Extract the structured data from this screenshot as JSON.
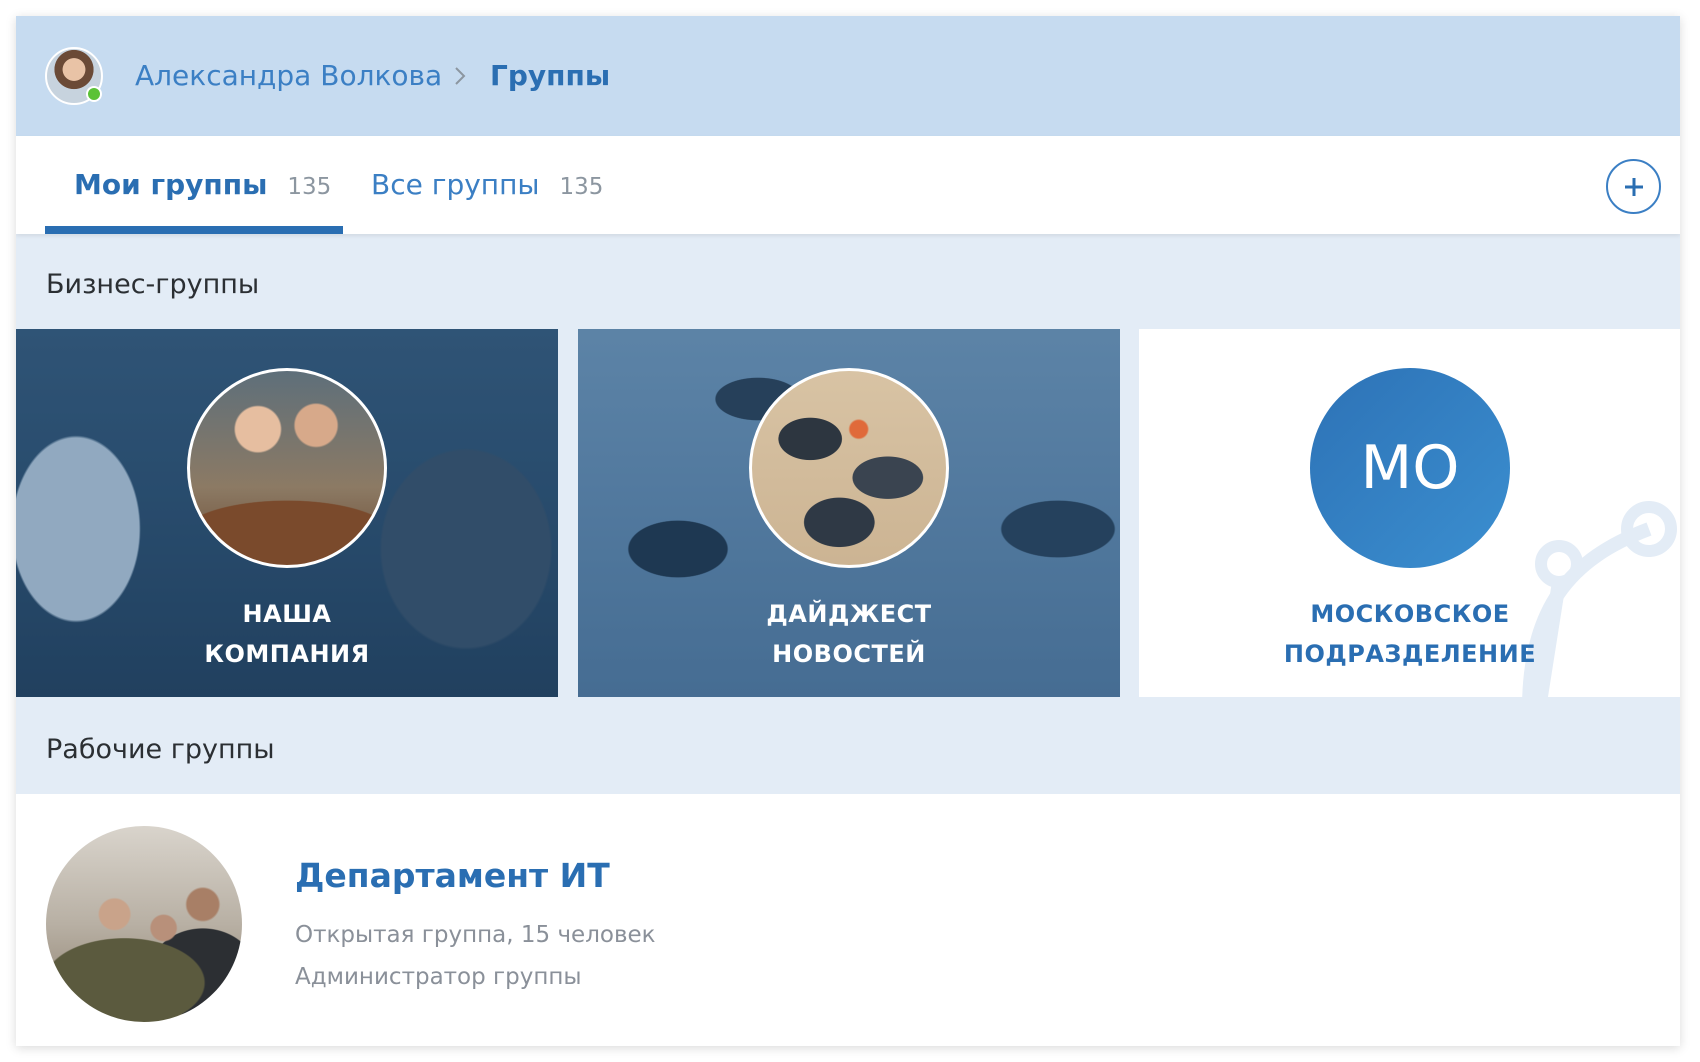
{
  "header": {
    "user_name": "Александра Волкова",
    "current_page": "Группы"
  },
  "tabs": [
    {
      "label": "Мои группы",
      "count": "135",
      "active": true
    },
    {
      "label": "Все группы",
      "count": "135",
      "active": false
    }
  ],
  "sections": {
    "business": "Бизнес-группы",
    "work": "Рабочие группы"
  },
  "business_groups": [
    {
      "title_line1": "НАША",
      "title_line2": "КОМПАНИЯ"
    },
    {
      "title_line1": "ДАЙДЖЕСТ",
      "title_line2": "НОВОСТЕЙ"
    },
    {
      "initials": "МО",
      "title_line1": "МОСКОВСКОЕ",
      "title_line2": "ПОДРАЗДЕЛЕНИЕ"
    }
  ],
  "work_groups": [
    {
      "title": "Департамент ИТ",
      "meta": "Открытая группа, 15 человек",
      "role": "Администратор группы"
    }
  ],
  "colors": {
    "accent": "#2a6eb2",
    "header_bg": "#c6dbf0",
    "page_bg": "#e3ecf6",
    "online": "#5bc236"
  },
  "icons": {
    "breadcrumb_separator": "chevron-right-icon",
    "add": "plus-icon"
  }
}
